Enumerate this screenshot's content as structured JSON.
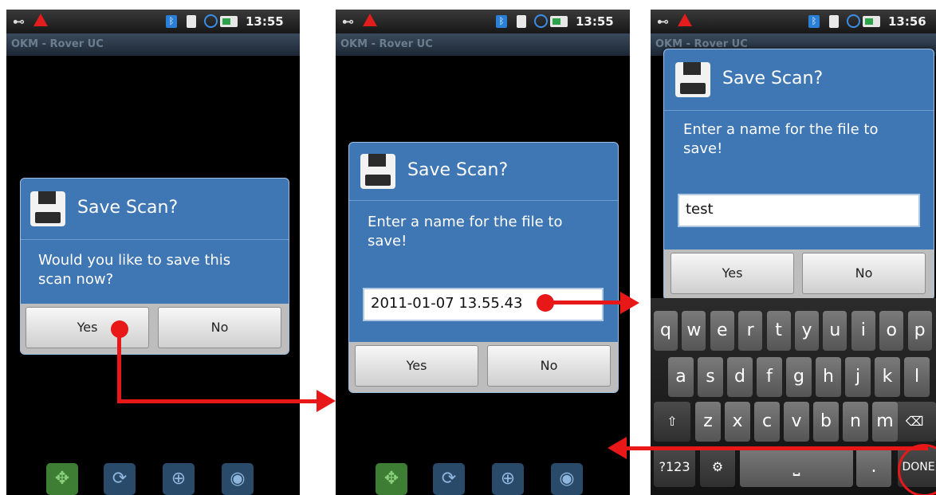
{
  "status": {
    "time_1": "13:55",
    "time_2": "13:55",
    "time_3": "13:56"
  },
  "app_title": "OKM - Rover UC",
  "dialog_confirm": {
    "title": "Save Scan?",
    "message": "Would you like to save this scan now?",
    "yes_label": "Yes",
    "no_label": "No"
  },
  "dialog_name": {
    "title": "Save Scan?",
    "message": "Enter a name for the file to save!",
    "default_value": "2011-01-07 13.55.43",
    "yes_label": "Yes",
    "no_label": "No"
  },
  "dialog_name_typed": {
    "title": "Save Scan?",
    "message": "Enter a name for the file to save!",
    "value": "test",
    "yes_label": "Yes",
    "no_label": "No"
  },
  "keyboard": {
    "row1": [
      "q",
      "w",
      "e",
      "r",
      "t",
      "y",
      "u",
      "i",
      "o",
      "p"
    ],
    "row2": [
      "a",
      "s",
      "d",
      "f",
      "g",
      "h",
      "j",
      "k",
      "l"
    ],
    "row3": [
      "z",
      "x",
      "c",
      "v",
      "b",
      "n",
      "m"
    ],
    "sym_label": "?123",
    "period_label": ".",
    "done_label": "DONE",
    "shift_icon": "shift-icon",
    "backspace_icon": "backspace-icon",
    "settings_icon": "gear-icon",
    "space_icon": "space-icon"
  },
  "toolbar_icons": [
    "move-icon",
    "rotate-icon",
    "zoom-icon",
    "eye-icon"
  ],
  "colors": {
    "dialog_blue": "#3f76b4",
    "annotation_red": "#e81818"
  }
}
